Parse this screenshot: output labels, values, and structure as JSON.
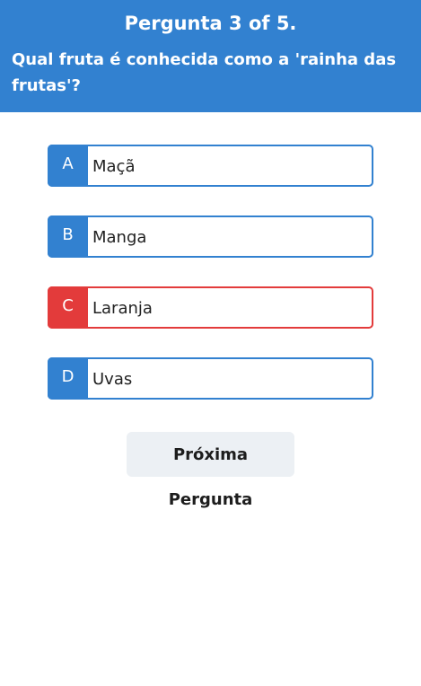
{
  "header": {
    "counter": "Pergunta 3 of 5.",
    "question": "Qual fruta é conhecida como a 'rainha das frutas'?"
  },
  "options": [
    {
      "letter": "A",
      "text": "Maçã",
      "state": "default"
    },
    {
      "letter": "B",
      "text": "Manga",
      "state": "default"
    },
    {
      "letter": "C",
      "text": "Laranja",
      "state": "wrong"
    },
    {
      "letter": "D",
      "text": "Uvas",
      "state": "default"
    }
  ],
  "next_button": {
    "label": "Próxima Pergunta"
  },
  "colors": {
    "primary": "#3281d0",
    "wrong": "#e33b3b",
    "button_bg": "#ecf0f4"
  }
}
